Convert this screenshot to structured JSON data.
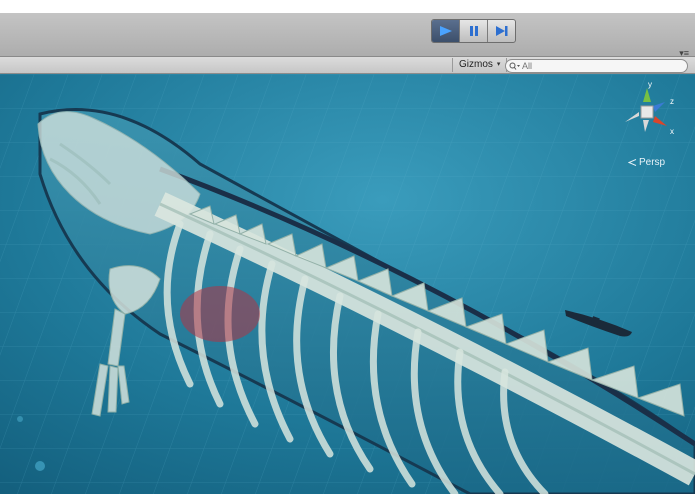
{
  "toolbar": {
    "play_icon": "play-icon",
    "pause_icon": "pause-icon",
    "step_icon": "step-icon"
  },
  "scene_view": {
    "gizmos_label": "Gizmos",
    "gizmos_arrow": "▾",
    "search_placeholder": "All",
    "persp_label": "Persp",
    "axis_labels": {
      "y": "y",
      "z": "z",
      "x": "x"
    }
  },
  "colors": {
    "water": "#1f7d9e",
    "bone": "#d8e4dc",
    "play_active": "#3c4f6b",
    "axis_y": "#76c043",
    "axis_z": "#3a7bd5",
    "axis_x": "#d9452b"
  }
}
